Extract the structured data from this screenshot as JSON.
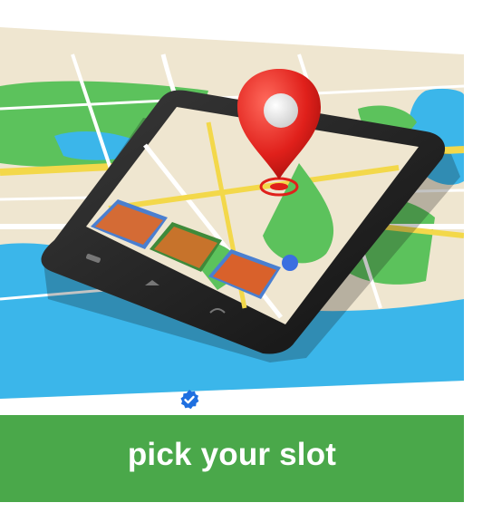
{
  "hero": {
    "icon": "map-with-smartphone-and-location-pin",
    "colors": {
      "water": "#3bb6ea",
      "park": "#5cc25c",
      "road_major": "#f3d84a",
      "land": "#efe6d0",
      "pin": "#e0201b",
      "phone_body": "#222222"
    }
  },
  "badge": {
    "icon": "verified-check-icon",
    "color": "#1e6fe0"
  },
  "cta": {
    "label": "pick your slot",
    "color": "#4aa84a"
  }
}
